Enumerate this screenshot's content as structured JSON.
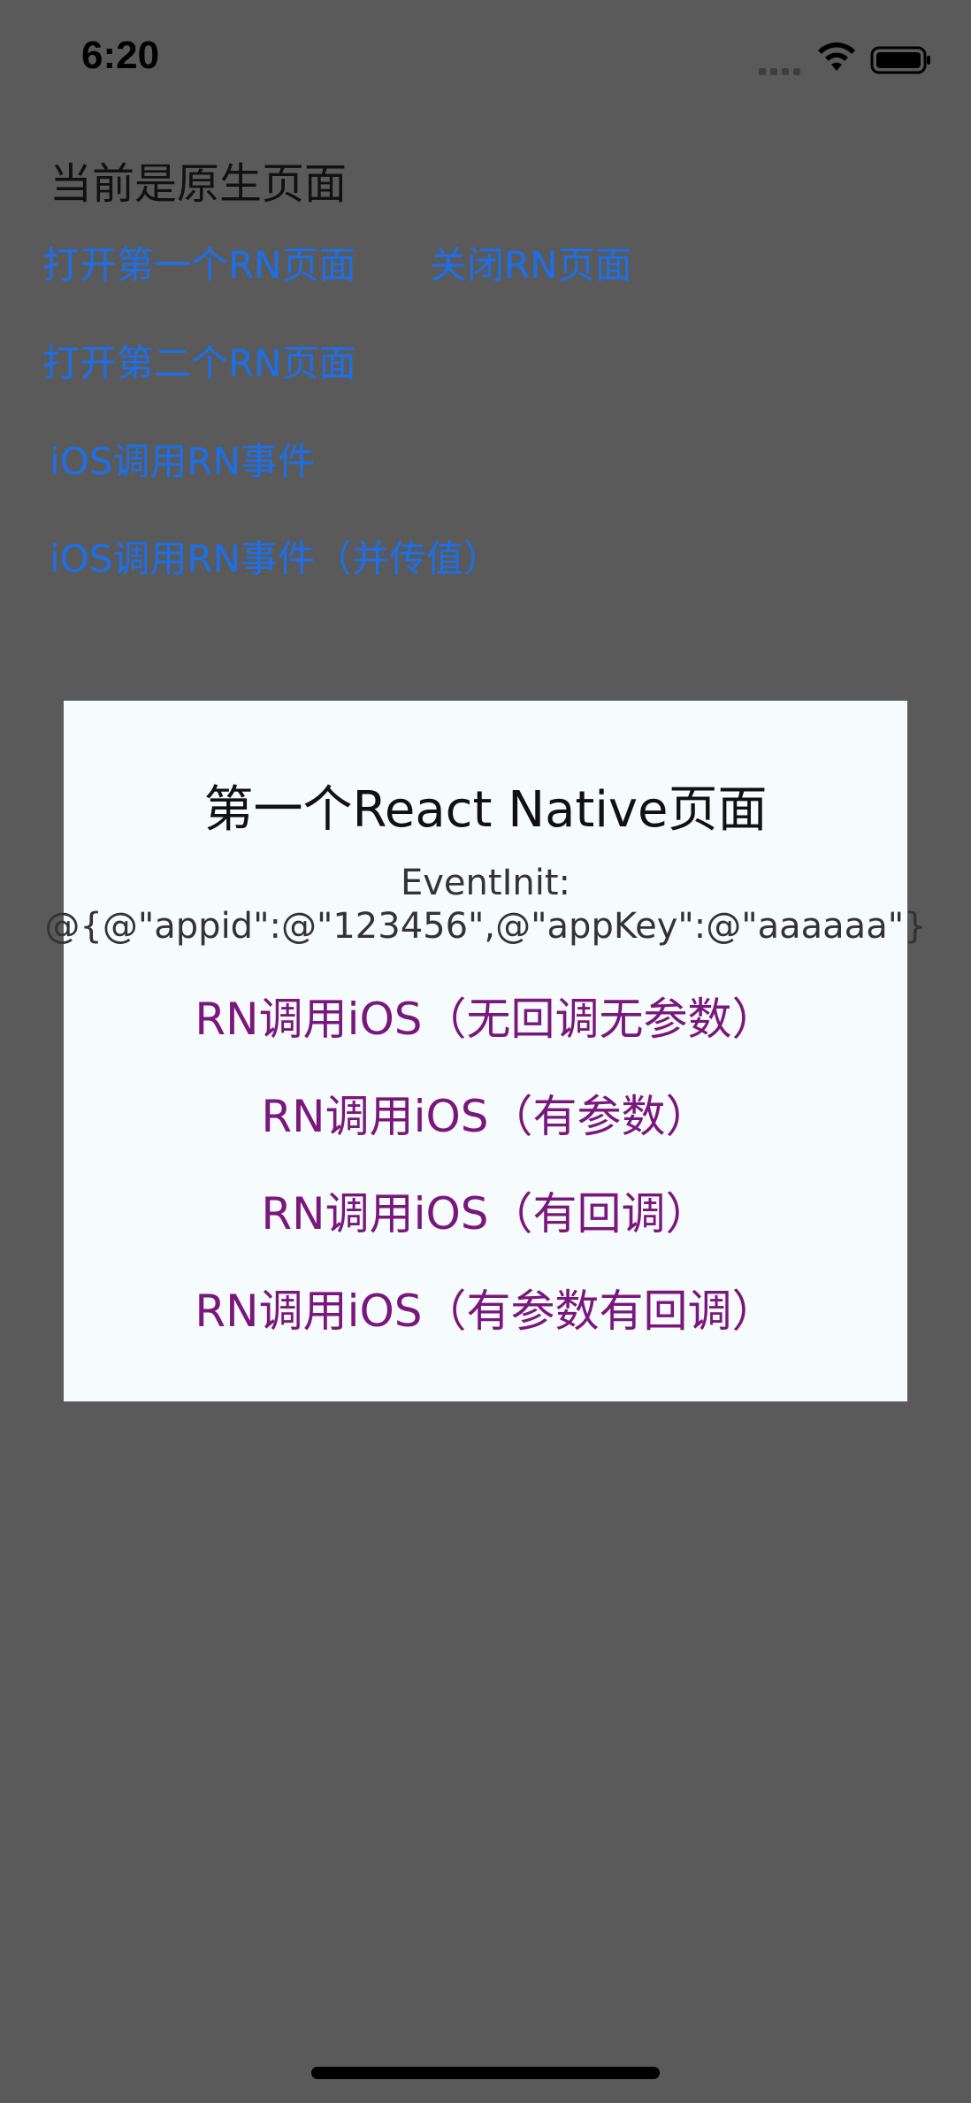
{
  "status_bar": {
    "time": "6:20"
  },
  "native": {
    "title": "当前是原生页面",
    "open_first_rn": "打开第一个RN页面",
    "close_rn": "关闭RN页面",
    "open_second_rn": "打开第二个RN页面",
    "ios_call_rn_event": "iOS调用RN事件",
    "ios_call_rn_event_with_value": "iOS调用RN事件（并传值）",
    "link_color": "#1d6fe8"
  },
  "rn_page": {
    "title": "第一个React Native页面",
    "event_label": "EventInit:",
    "event_value": "@{@\"appid\":@\"123456\",@\"appKey\":@\"aaaaaa\"}",
    "buttons": [
      "RN调用iOS（无回调无参数）",
      "RN调用iOS（有参数）",
      "RN调用iOS（有回调）",
      "RN调用iOS（有参数有回调）"
    ],
    "button_color": "#7a167c",
    "background": "#f6fbfe"
  },
  "icons": {
    "signal": "cellular-signal-icon",
    "wifi": "wifi-icon",
    "battery": "battery-icon"
  }
}
